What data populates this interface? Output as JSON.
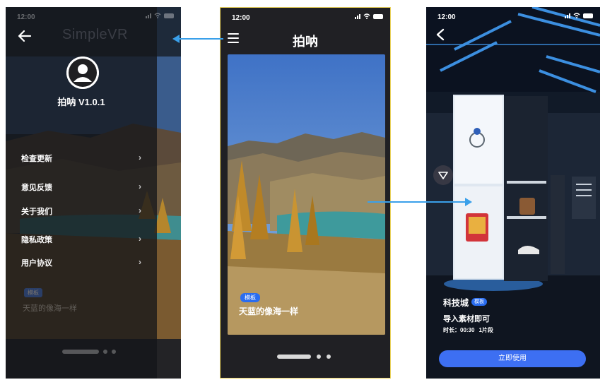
{
  "drawer_screen": {
    "status_time": "12:00",
    "app_title": "SimpleVR",
    "version": "拍呐 V1.0.1",
    "menu_items": [
      {
        "label": "检查更新"
      },
      {
        "label": "意见反馈"
      },
      {
        "label": "关于我们"
      },
      {
        "label": "隐私政策"
      },
      {
        "label": "用户协议"
      }
    ],
    "tag": "模板",
    "caption": "天蓝的像海一样"
  },
  "main_screen": {
    "status_time": "12:00",
    "title": "拍呐",
    "tag": "模板",
    "caption": "天蓝的像海一样"
  },
  "vr_screen": {
    "status_time": "12:00",
    "name": "科技城",
    "badge": "模板",
    "subtitle": "导入素材即可",
    "duration": "时长：00:30",
    "segments": "1片段",
    "use_button": "立即使用"
  },
  "colors": {
    "accent_blue": "#2a6df0",
    "button_blue": "#3d6ff2",
    "arrow_blue": "#3aa0ea",
    "phone_dark": "#202024",
    "frame_yellow": "#e8d15a"
  },
  "icons": {
    "back": "arrow-left-icon",
    "menu": "hamburger-menu-icon",
    "avatar": "user-avatar-icon",
    "chevron": "chevron-right-icon",
    "vr": "vr-view-icon"
  }
}
